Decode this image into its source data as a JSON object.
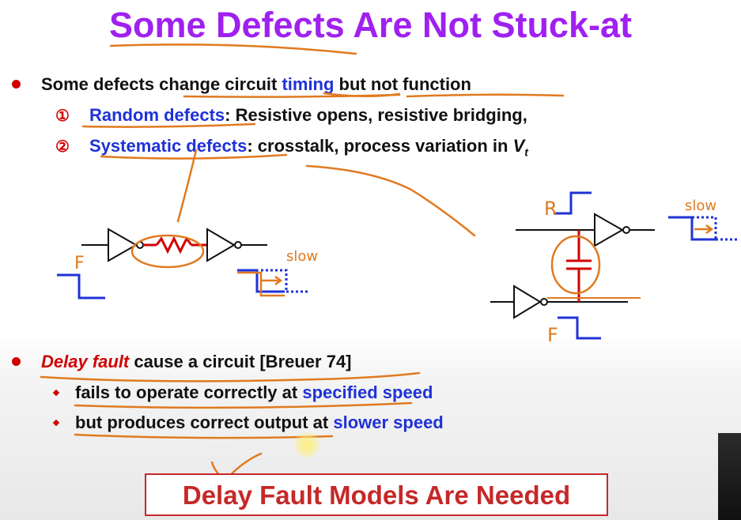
{
  "title": "Some Defects Are Not Stuck-at",
  "bullet1": {
    "text_a": "Some defects change circuit ",
    "text_timing": "timing",
    "text_b": " but not function"
  },
  "sub1": {
    "marker": "①",
    "label": "Random defects",
    "rest": ": Resistive opens, resistive bridging,"
  },
  "sub2": {
    "marker": "②",
    "label": "Systematic defects",
    "rest": ": crosstalk, process variation in ",
    "var": "V",
    "var_sub": "t"
  },
  "sketch_labels": {
    "left_input": "F",
    "left_output": "slow",
    "right_aggressor": "R",
    "right_output": "slow",
    "right_victim": "F"
  },
  "bullet2": {
    "label": "Delay fault",
    "rest": " cause a circuit [Breuer 74]"
  },
  "bullet2_items": [
    {
      "text": "fails to operate correctly at ",
      "emph": "specified speed"
    },
    {
      "text": "but produces correct output at ",
      "emph": "slower speed"
    }
  ],
  "conclusion": "Delay Fault Models Are Needed",
  "colors": {
    "title": "#a020f0",
    "emphasis_blue": "#1f32d6",
    "bullet_red": "#d00000",
    "annotation_orange": "#e07a1f",
    "conclusion_red": "#c62828"
  }
}
